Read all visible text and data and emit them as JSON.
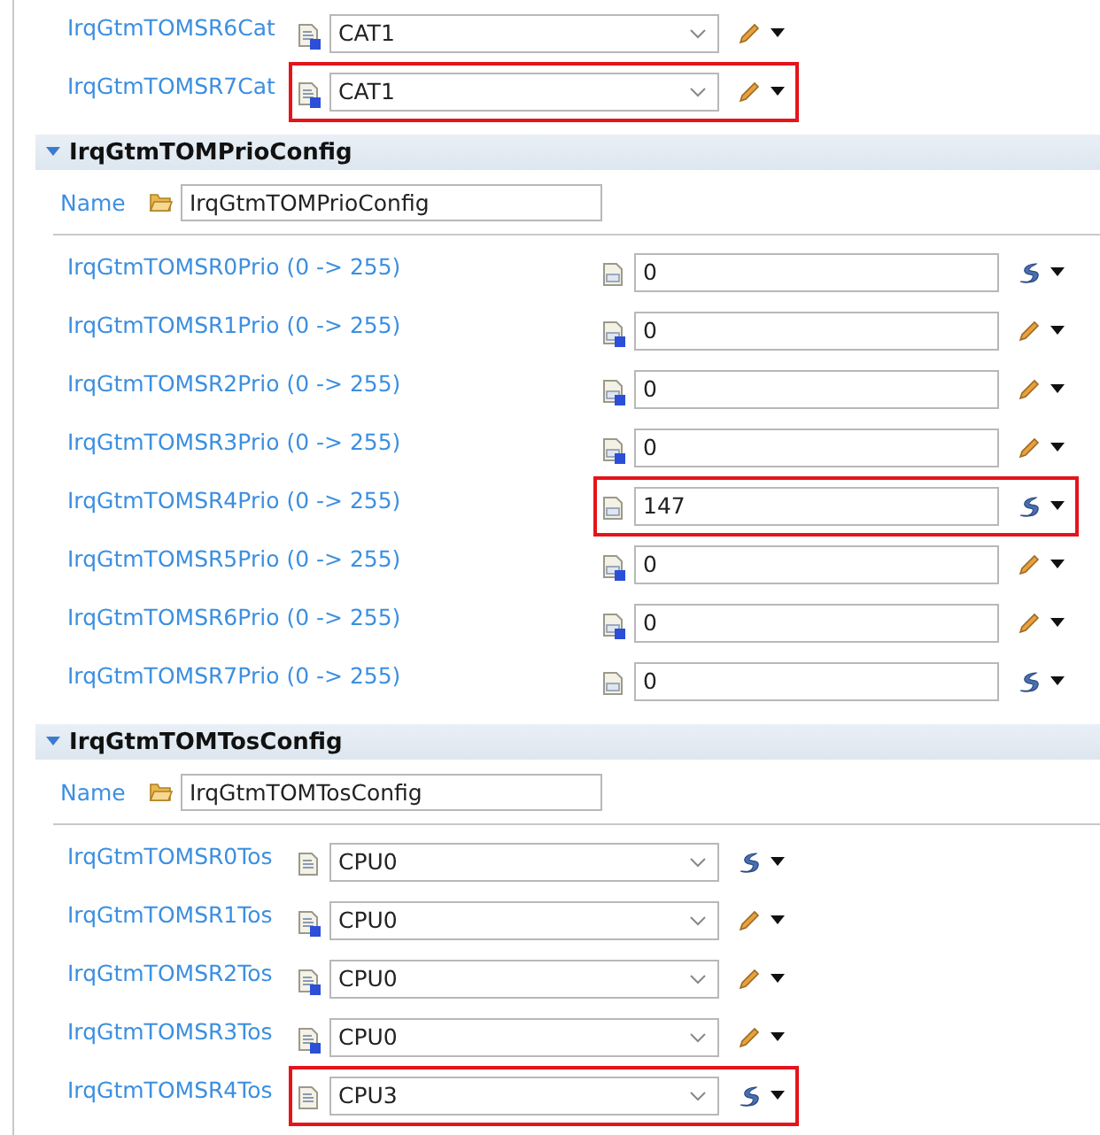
{
  "sections": [
    {
      "kind": "combo",
      "rows": [
        {
          "label": "IrqGtmTOMSR6Cat",
          "kind": "default",
          "value": "CAT1",
          "highlighted": false
        },
        {
          "label": "IrqGtmTOMSR7Cat",
          "kind": "default",
          "value": "CAT1",
          "highlighted": true
        }
      ]
    },
    {
      "title": "IrqGtmTOMPrioConfig",
      "expanded": true,
      "name_label": "Name",
      "name_value": "IrqGtmTOMPrioConfig",
      "kind": "text",
      "rows": [
        {
          "label": "IrqGtmTOMSR0Prio (0 -> 255)",
          "kind": "derived",
          "value": "0",
          "highlighted": false
        },
        {
          "label": "IrqGtmTOMSR1Prio (0 -> 255)",
          "kind": "default",
          "value": "0",
          "highlighted": false
        },
        {
          "label": "IrqGtmTOMSR2Prio (0 -> 255)",
          "kind": "default",
          "value": "0",
          "highlighted": false
        },
        {
          "label": "IrqGtmTOMSR3Prio (0 -> 255)",
          "kind": "default",
          "value": "0",
          "highlighted": false
        },
        {
          "label": "IrqGtmTOMSR4Prio (0 -> 255)",
          "kind": "derived",
          "value": "147",
          "highlighted": true
        },
        {
          "label": "IrqGtmTOMSR5Prio (0 -> 255)",
          "kind": "default",
          "value": "0",
          "highlighted": false
        },
        {
          "label": "IrqGtmTOMSR6Prio (0 -> 255)",
          "kind": "default",
          "value": "0",
          "highlighted": false
        },
        {
          "label": "IrqGtmTOMSR7Prio (0 -> 255)",
          "kind": "derived",
          "value": "0",
          "highlighted": false
        }
      ]
    },
    {
      "title": "IrqGtmTOMTosConfig",
      "expanded": true,
      "name_label": "Name",
      "name_value": "IrqGtmTOMTosConfig",
      "kind": "combo",
      "rows": [
        {
          "label": "IrqGtmTOMSR0Tos",
          "kind": "derived",
          "value": "CPU0",
          "highlighted": false
        },
        {
          "label": "IrqGtmTOMSR1Tos",
          "kind": "default",
          "value": "CPU0",
          "highlighted": false
        },
        {
          "label": "IrqGtmTOMSR2Tos",
          "kind": "default",
          "value": "CPU0",
          "highlighted": false
        },
        {
          "label": "IrqGtmTOMSR3Tos",
          "kind": "default",
          "value": "CPU0",
          "highlighted": false
        },
        {
          "label": "IrqGtmTOMSR4Tos",
          "kind": "derived",
          "value": "CPU3",
          "highlighted": true
        }
      ]
    }
  ]
}
